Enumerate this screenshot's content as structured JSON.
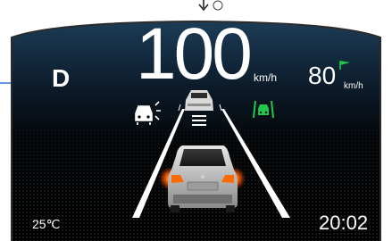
{
  "drive": {
    "gear": "D"
  },
  "speed": {
    "value": "100",
    "unit": "km/h"
  },
  "speed_limit": {
    "value": "80",
    "unit": "km/h"
  },
  "status": {
    "outside_temperature": "25℃",
    "clock": "20:02"
  },
  "icons": [
    "distance-warning-icon",
    "lane-keep-assist-icon",
    "lead-vehicle-icon",
    "own-vehicle-icon",
    "set-speed-flag-icon",
    "gap-bars-icon"
  ],
  "colors": {
    "background": "#000000",
    "accent_green": "#1fc84a",
    "turn_signal": "#ff6a00",
    "text": "#ffffff"
  }
}
